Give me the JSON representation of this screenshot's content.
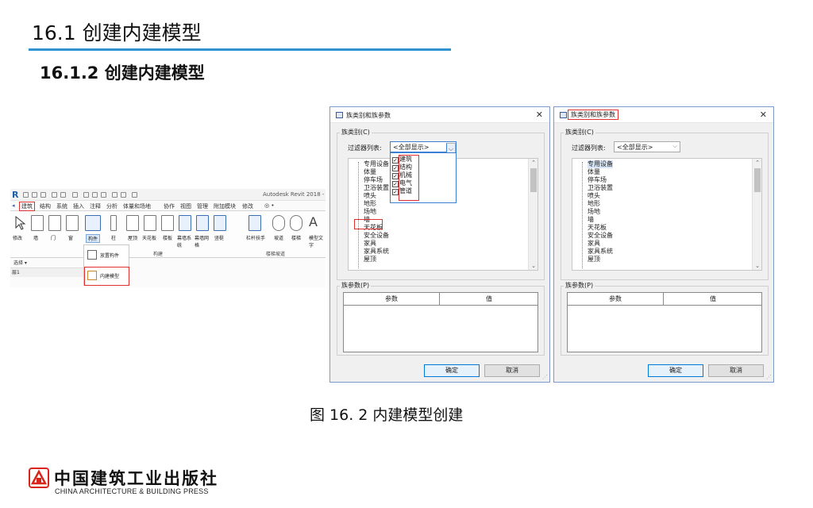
{
  "slide": {
    "title": "16.1 创建内建模型",
    "subtitle": "16.1.2   创建内建模型",
    "caption": "图 16. 2 内建模型创建"
  },
  "ribbon": {
    "app_title": "Autodesk Revit 2018 -",
    "tabs": [
      "建筑",
      "结构",
      "系统",
      "插入",
      "注释",
      "分析",
      "体量和场地",
      "协作",
      "视图",
      "管理",
      "附加模块",
      "修改",
      "◎ •"
    ],
    "active_tab_index": 0,
    "tools": [
      "修改",
      "墙",
      "门",
      "窗",
      "构件",
      "柱",
      "屋顶",
      "天花板",
      "楼板",
      "幕墙系统",
      "幕墙网格",
      "竖梃",
      "栏杆扶手",
      "坡道",
      "楼梯",
      "模型文字"
    ],
    "panels": {
      "select": "选择 ▾",
      "build": "构建",
      "circulation": "楼梯坡道"
    },
    "menu_items": [
      "放置构件",
      "内建模型"
    ],
    "level": "层1"
  },
  "dialog_left": {
    "title": "族类别和族参数",
    "group_category": "族类别(C)",
    "filter_label": "过滤器列表:",
    "filter_value": "<全部显示>",
    "filter_options": [
      "建筑",
      "结构",
      "机械",
      "电气",
      "管道"
    ],
    "tree_items": [
      "专用设备",
      "体量",
      "停车场",
      "卫浴装置",
      "喷头",
      "地形",
      "场地",
      "墙",
      "天花板",
      "安全设备",
      "家具",
      "家具系统",
      "屋顶"
    ],
    "group_params": "族参数(P)",
    "col_param": "参数",
    "col_value": "值",
    "ok": "确定",
    "cancel": "取消"
  },
  "dialog_right": {
    "title": "族类别和族参数",
    "group_category": "族类别(C)",
    "filter_label": "过滤器列表:",
    "filter_value": "<全部显示>",
    "tree_items": [
      "专用设备",
      "体量",
      "停车场",
      "卫浴装置",
      "喷头",
      "地形",
      "场地",
      "墙",
      "天花板",
      "安全设备",
      "家具",
      "家具系统",
      "屋顶"
    ],
    "group_params": "族参数(P)",
    "col_param": "参数",
    "col_value": "值",
    "ok": "确定",
    "cancel": "取消"
  },
  "logo": {
    "cn": "中国建筑工业出版社",
    "en": "CHINA ARCHITECTURE & BUILDING PRESS"
  },
  "colors": {
    "accent_rule": "#2f93d2",
    "highlight": "#e03030",
    "dialog_focus": "#3b7fd4"
  }
}
